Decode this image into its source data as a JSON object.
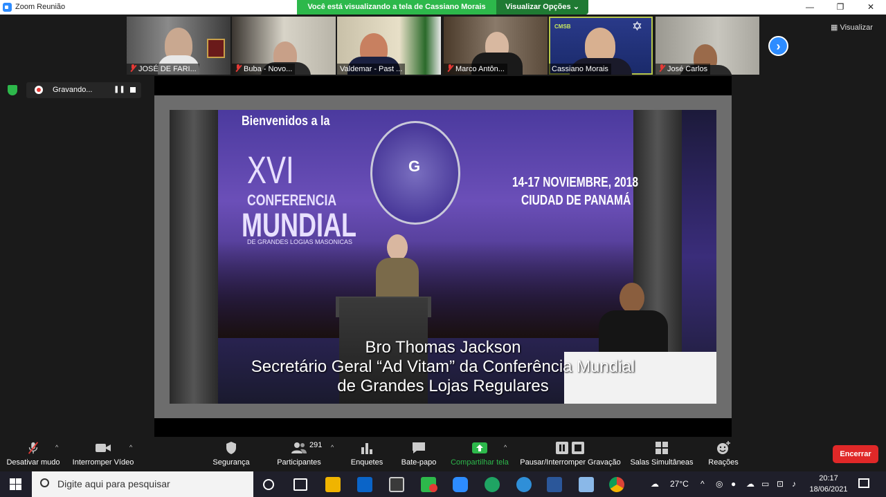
{
  "window": {
    "title": "Zoom Reunião",
    "minimize": "—",
    "restore": "❐",
    "close": "✕"
  },
  "share_banner": {
    "message": "Você está visualizando a tela de Cassiano Morais",
    "options_label": "Visualizar Opções"
  },
  "view_button": "Visualizar",
  "participants_strip": [
    {
      "name": "JOSÉ DE FARI...",
      "muted": true
    },
    {
      "name": "Buba - Novo...",
      "muted": true
    },
    {
      "name": "Valdemar - Past ...",
      "muted": false
    },
    {
      "name": "Marco Antôn...",
      "muted": true
    },
    {
      "name": "Cassiano Morais",
      "muted": false,
      "active": true,
      "badge": "CMSB"
    },
    {
      "name": "José Carlos",
      "muted": true
    }
  ],
  "recording": {
    "status": "Gravando..."
  },
  "slide": {
    "welcome": "Bienvenidos a la",
    "numeral": "XVI",
    "conference": "CONFERENCIA",
    "world": "MUNDIAL",
    "subtitle": "DE GRANDES LOGIAS MASONICAS",
    "emblem_letter": "G",
    "date": "14-17 NOVIEMBRE, 2018",
    "city": "CIUDAD DE PANAMÁ",
    "caption_line1": "Bro Thomas Jackson",
    "caption_line2": "Secretário Geral “Ad Vitam” da Conferência Mundial",
    "caption_line3": "de Grandes Lojas Regulares"
  },
  "toolbar": {
    "mute": "Desativar mudo",
    "video": "Interromper Vídeo",
    "security": "Segurança",
    "participants": "Participantes",
    "participants_count": "291",
    "polls": "Enquetes",
    "chat": "Bate-papo",
    "share": "Compartilhar tela",
    "record": "Pausar/Interromper Gravação",
    "breakout": "Salas Simultâneas",
    "reactions": "Reações",
    "end": "Encerrar"
  },
  "taskbar": {
    "search_placeholder": "Digite aqui para pesquisar",
    "temperature": "27°C",
    "time": "20:17",
    "date": "18/06/2021"
  },
  "colors": {
    "zoom_blue": "#2d8cff",
    "share_green": "#2db84b",
    "end_red": "#e02828",
    "muted_red": "#e53935"
  }
}
